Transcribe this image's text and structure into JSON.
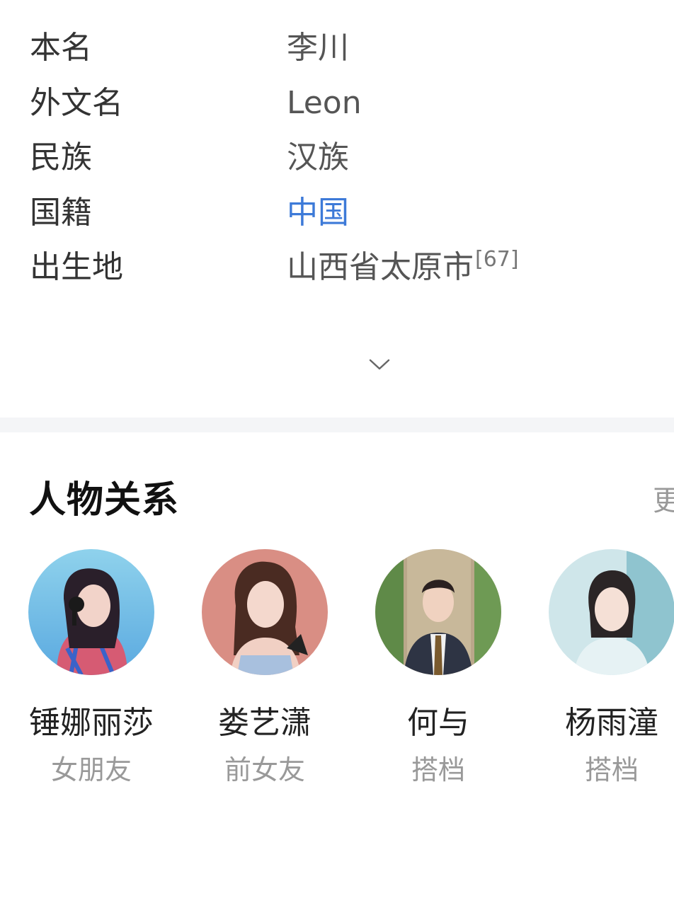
{
  "basic_info": {
    "rows": [
      {
        "label": "本名",
        "value": "李川"
      },
      {
        "label": "外文名",
        "value": "Leon"
      },
      {
        "label": "民族",
        "value": "汉族"
      },
      {
        "label": "国籍",
        "value": "中国"
      },
      {
        "label": "出生地",
        "value": "山西省太原市",
        "ref": "[67]"
      }
    ],
    "expand_icon": "chevron-down-icon"
  },
  "relations": {
    "title": "人物关系",
    "more_label": "更",
    "people": [
      {
        "name": "锤娜丽莎",
        "relation": "女朋友"
      },
      {
        "name": "娄艺潇",
        "relation": "前女友"
      },
      {
        "name": "何与",
        "relation": "搭档"
      },
      {
        "name": "杨雨潼",
        "relation": "搭档"
      }
    ]
  },
  "colors": {
    "link": "#3d7ad8",
    "divider_band": "#f4f5f7"
  }
}
